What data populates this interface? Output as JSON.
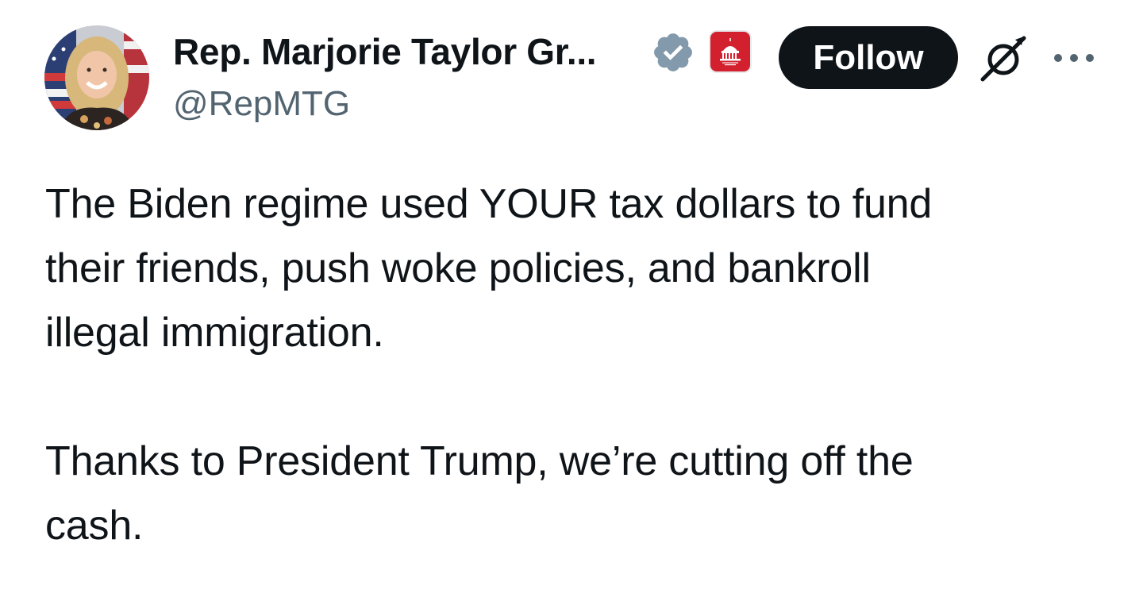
{
  "author": {
    "display_name": "Rep. Marjorie Taylor Gr...",
    "handle": "@RepMTG",
    "verified_badge_icon": "verified-badge-icon",
    "affiliation_badge_icon": "capitol-dome-icon",
    "affiliation_color": "#d2202f",
    "verified_color": "#829aab"
  },
  "actions": {
    "follow_label": "Follow",
    "grok_icon": "grok-icon",
    "more_icon": "more-options-icon"
  },
  "tweet": {
    "text": "The Biden regime used YOUR tax dollars to fund\ntheir friends, push woke policies, and bankroll\nillegal immigration.\n\nThanks to President Trump, we’re cutting off the\ncash."
  },
  "colors": {
    "primary_text": "#0f1419",
    "secondary_text": "#536471",
    "button_bg": "#0f1419",
    "button_text": "#ffffff"
  }
}
